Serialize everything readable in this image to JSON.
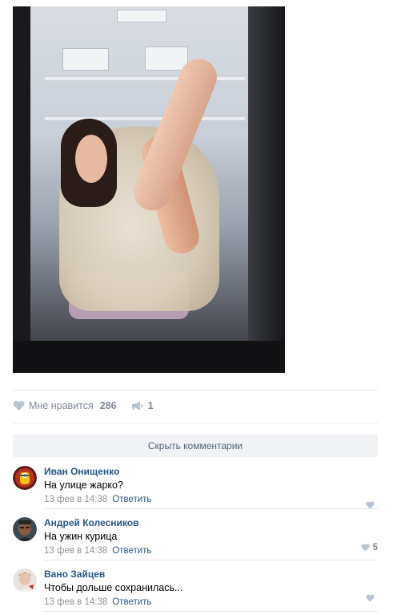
{
  "post": {
    "likes_label": "Мне нравится",
    "likes_count": "286",
    "shares_count": "1"
  },
  "comments_toggle": "Скрыть комментарии",
  "comments": [
    {
      "author": "Иван Онищенко",
      "text": "На улице жарко?",
      "date": "13 фев в 14:38",
      "reply": "Ответить",
      "likes": ""
    },
    {
      "author": "Андрей Колесников",
      "text": "На ужин курица",
      "date": "13 фев в 14:38",
      "reply": "Ответить",
      "likes": "5"
    },
    {
      "author": "Вано Зайцев",
      "text": "Чтобы дольше сохранилась...",
      "date": "13 фев в 14:38",
      "reply": "Ответить",
      "likes": ""
    }
  ],
  "colors": {
    "link": "#2a5885",
    "meta": "#939393",
    "action": "#828a99",
    "icon": "#b9c4d2",
    "bar": "#f0f2f5"
  }
}
